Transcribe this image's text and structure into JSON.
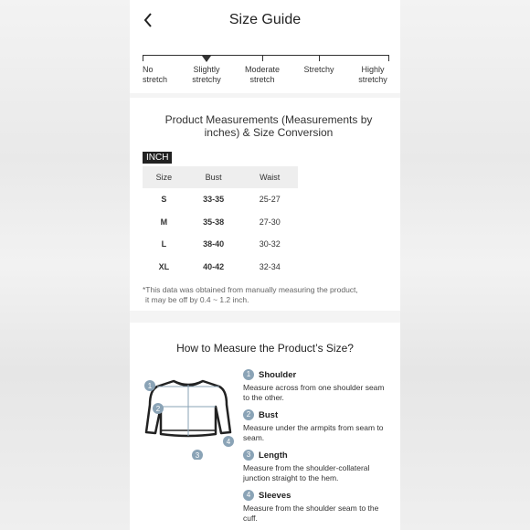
{
  "header": {
    "title": "Size Guide",
    "back_icon": "chevron-left-icon"
  },
  "stretch": {
    "levels": [
      {
        "line1": "No",
        "line2": "stretch"
      },
      {
        "line1": "Slightly",
        "line2": "stretchy"
      },
      {
        "line1": "Moderate",
        "line2": "stretch"
      },
      {
        "line1": "Stretchy",
        "line2": ""
      },
      {
        "line1": "Highly",
        "line2": "stretchy"
      }
    ],
    "selected_index": 1
  },
  "measurements": {
    "title": "Product Measurements (Measurements by inches) & Size Conversion",
    "unit": "INCH",
    "columns": [
      "Size",
      "Bust",
      "Waist"
    ],
    "rows": [
      [
        "S",
        "33-35",
        "25-27"
      ],
      [
        "M",
        "35-38",
        "27-30"
      ],
      [
        "L",
        "38-40",
        "30-32"
      ],
      [
        "XL",
        "40-42",
        "32-34"
      ]
    ],
    "note_line1": "*This data was obtained from manually measuring the product,",
    "note_line2": "it may be off by 0.4 ~ 1.2 inch."
  },
  "howto": {
    "title": "How to Measure the Product’s Size?",
    "steps": [
      {
        "num": "1",
        "title": "Shoulder",
        "desc": "Measure across from one shoulder seam to the other."
      },
      {
        "num": "2",
        "title": "Bust",
        "desc": "Measure under the armpits from seam to seam."
      },
      {
        "num": "3",
        "title": "Length",
        "desc": "Measure from the shoulder-collateral junction straight to the hem."
      },
      {
        "num": "4",
        "title": "Sleeves",
        "desc": "Measure from the shoulder seam to the cuff."
      }
    ],
    "diagram_markers": [
      "1",
      "2",
      "3",
      "4"
    ]
  }
}
